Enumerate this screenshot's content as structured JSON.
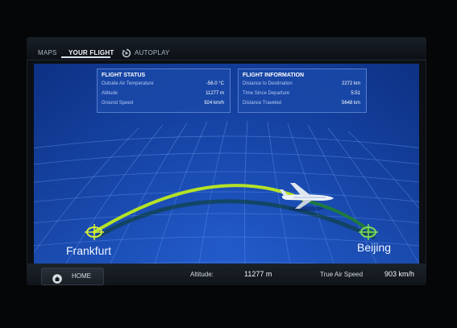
{
  "tabs": [
    {
      "label": "MAPS",
      "active": false
    },
    {
      "label": "YOUR FLIGHT",
      "active": true
    },
    {
      "label": "AUTOPLAY",
      "active": false
    }
  ],
  "flight_status": {
    "title": "FLIGHT STATUS",
    "rows": [
      {
        "label": "Outside Air Temperature",
        "value": "-56.0 °C"
      },
      {
        "label": "Altitude",
        "value": "11277 m"
      },
      {
        "label": "Ground Speed",
        "value": "924 km/h"
      }
    ]
  },
  "flight_information": {
    "title": "FLIGHT INFORMATION",
    "rows": [
      {
        "label": "Distance to Destination",
        "value": "2272 km"
      },
      {
        "label": "Time Since Departure",
        "value": "5:51"
      },
      {
        "label": "Distance Traveled",
        "value": "5648 km"
      }
    ]
  },
  "map": {
    "origin": "Frankfurt",
    "destination": "Beijing",
    "route_color": "#b4e227",
    "grid_color": "#7fb1ff"
  },
  "bottom_bar": {
    "home_label": "HOME",
    "altitude_label": "Altitude:",
    "altitude_value": "11277 m",
    "airspeed_label": "True Air Speed",
    "airspeed_value": "903 km/h"
  },
  "icons": [
    "autoplay-icon",
    "home-icon",
    "airplane-icon",
    "origin-airport-icon",
    "destination-airport-icon"
  ]
}
